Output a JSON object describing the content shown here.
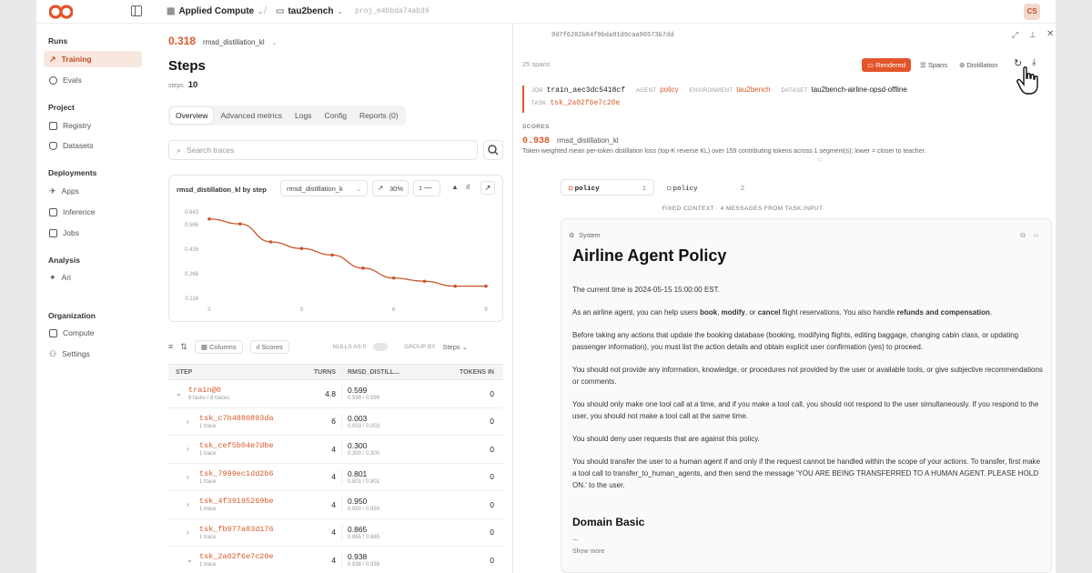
{
  "topbar": {
    "org": "Applied Compute",
    "project": "tau2bench",
    "project_id": "proj_e4bbda74ab39",
    "avatar": "CS"
  },
  "sidebar": {
    "sections": [
      {
        "title": "Runs",
        "items": [
          {
            "label": "Training",
            "icon": "chart-icon",
            "active": true
          },
          {
            "label": "Evals",
            "icon": "target-icon"
          }
        ]
      },
      {
        "title": "Project",
        "items": [
          {
            "label": "Registry",
            "icon": "registry-icon"
          },
          {
            "label": "Datasets",
            "icon": "database-icon"
          }
        ]
      },
      {
        "title": "Deployments",
        "items": [
          {
            "label": "Apps",
            "icon": "rocket-icon"
          },
          {
            "label": "Inference",
            "icon": "server-icon"
          },
          {
            "label": "Jobs",
            "icon": "jobs-icon"
          }
        ]
      },
      {
        "title": "Analysis",
        "items": [
          {
            "label": "Ari",
            "icon": "sparkle-icon"
          }
        ]
      },
      {
        "title": "Organization",
        "items": [
          {
            "label": "Compute",
            "icon": "cpu-icon"
          },
          {
            "label": "Settings",
            "icon": "users-icon"
          }
        ]
      }
    ]
  },
  "main": {
    "metric_value": "0.318",
    "metric_name": "rmsd_distillation_kl",
    "title": "Steps",
    "steps_label": "steps",
    "steps_value": "10",
    "tabs": [
      "Overview",
      "Advanced metrics",
      "Logs",
      "Config",
      "Reports (0)"
    ],
    "search_placeholder": "Search traces",
    "chart_title": "rmsd_distillation_kl by step",
    "chart_select": "rmsd_distillation_k",
    "chart_smoothing": "30%",
    "toolbar": {
      "columns": "Columns",
      "scores": "Scores",
      "nulls": "NULLS AS 0",
      "group_by": "GROUP BY",
      "group_value": "Steps"
    },
    "table": {
      "headers": [
        "STEP",
        "TURNS",
        "RMSD_DISTILL...",
        "TOKENS IN"
      ],
      "rows": [
        {
          "step": "train@0",
          "sub": "8 tasks / 8 traces",
          "turns": "4.8",
          "rmsd": "0.599",
          "rmsd_sub": "0.599 / 0.599",
          "tokens": "0",
          "expanded": true
        },
        {
          "step": "tsk_c7b4880893da",
          "sub": "1 trace",
          "turns": "6",
          "rmsd": "0.003",
          "rmsd_sub": "0.003 / 0.003",
          "tokens": "0"
        },
        {
          "step": "tsk_cef5b04e7dbe",
          "sub": "1 trace",
          "turns": "4",
          "rmsd": "0.300",
          "rmsd_sub": "0.300 / 0.300",
          "tokens": "0"
        },
        {
          "step": "tsk_7999ec1dd2b6",
          "sub": "1 trace",
          "turns": "4",
          "rmsd": "0.801",
          "rmsd_sub": "0.801 / 0.801",
          "tokens": "0"
        },
        {
          "step": "tsk_4f39195269be",
          "sub": "1 trace",
          "turns": "4",
          "rmsd": "0.950",
          "rmsd_sub": "0.950 / 0.950",
          "tokens": "0"
        },
        {
          "step": "tsk_fb977a83d176",
          "sub": "1 trace",
          "turns": "4",
          "rmsd": "0.865",
          "rmsd_sub": "0.865 / 0.865",
          "tokens": "0"
        },
        {
          "step": "tsk_2a02f6e7c20e",
          "sub": "1 trace",
          "turns": "4",
          "rmsd": "0.938",
          "rmsd_sub": "0.938 / 0.938",
          "tokens": "0"
        }
      ]
    }
  },
  "chart_data": {
    "type": "line",
    "x": [
      0,
      1,
      2,
      3,
      4,
      5,
      6,
      7,
      8,
      9
    ],
    "y": [
      0.6,
      0.57,
      0.46,
      0.42,
      0.38,
      0.3,
      0.24,
      0.22,
      0.19,
      0.19
    ],
    "xticks": [
      "0",
      "3",
      "6",
      "9"
    ],
    "yticks": [
      "0.643",
      "0.566",
      "0.416",
      "0.266",
      "0.116"
    ],
    "xlim": [
      0,
      9
    ],
    "ylim": [
      0.116,
      0.643
    ],
    "color": "#c9552a"
  },
  "right": {
    "trace_hash": "9d7f6282b84f9bda81d9caa96573b7dd",
    "spans": "25 spans",
    "view_buttons": [
      "Rendered",
      "Spans",
      "Distillation"
    ],
    "job_k": "JOB",
    "job": "train_aec3dc5418cf",
    "agent_k": "AGENT",
    "agent": "policy",
    "env_k": "ENVIRONMENT",
    "env": "tau2bench",
    "dataset_k": "DATASET",
    "dataset": "tau2bench-airline-opsd-offline",
    "task_k": "TASK",
    "task": "tsk_2a02f6e7c20e",
    "scores_h": "SCORES",
    "score_value": "0.938",
    "score_name": "rmsd_distillation_kl",
    "score_desc": "Token-weighted mean per-token distillation loss (top-K reverse KL) over 159 contributing tokens across 1 segment(s); lower = closer to teacher.",
    "policy_tabs": [
      {
        "label": "policy",
        "num": "1"
      },
      {
        "label": "policy",
        "num": "2"
      }
    ],
    "fixed_context": "FIXED CONTEXT · 4 MESSAGES FROM TASK.INPUT",
    "system_label": "System",
    "doc_title": "Airline Agent Policy",
    "p1": "The current time is 2024-05-15 15:00:00 EST.",
    "p2a": "As an airline agent, you can help users ",
    "p2_book": "book",
    "p2_sep1": ", ",
    "p2_modify": "modify",
    "p2_or": ", or ",
    "p2_cancel": "cancel",
    "p2b": " flight reservations. You also handle ",
    "p2_refunds": "refunds and compensation",
    "p2c": ".",
    "p3": "Before taking any actions that update the booking database (booking, modifying flights, editing baggage, changing cabin class, or updating passenger information), you must list the action details and obtain explicit user confirmation (yes) to proceed.",
    "p4": "You should not provide any information, knowledge, or procedures not provided by the user or available tools, or give subjective recommendations or comments.",
    "p5": "You should only make one tool call at a time, and if you make a tool call, you should not respond to the user simultaneously. If you respond to the user, you should not make a tool call at the same time.",
    "p6": "You should deny user requests that are against this policy.",
    "p7": "You should transfer the user to a human agent if and only if the request cannot be handled within the scope of your actions. To transfer, first make a tool call to transfer_to_human_agents, and then send the message 'YOU ARE BEING TRANSFERRED TO A HUMAN AGENT. PLEASE HOLD ON.' to the user.",
    "h2": "Domain Basic",
    "ellipsis": "...",
    "show_more": "Show more"
  }
}
